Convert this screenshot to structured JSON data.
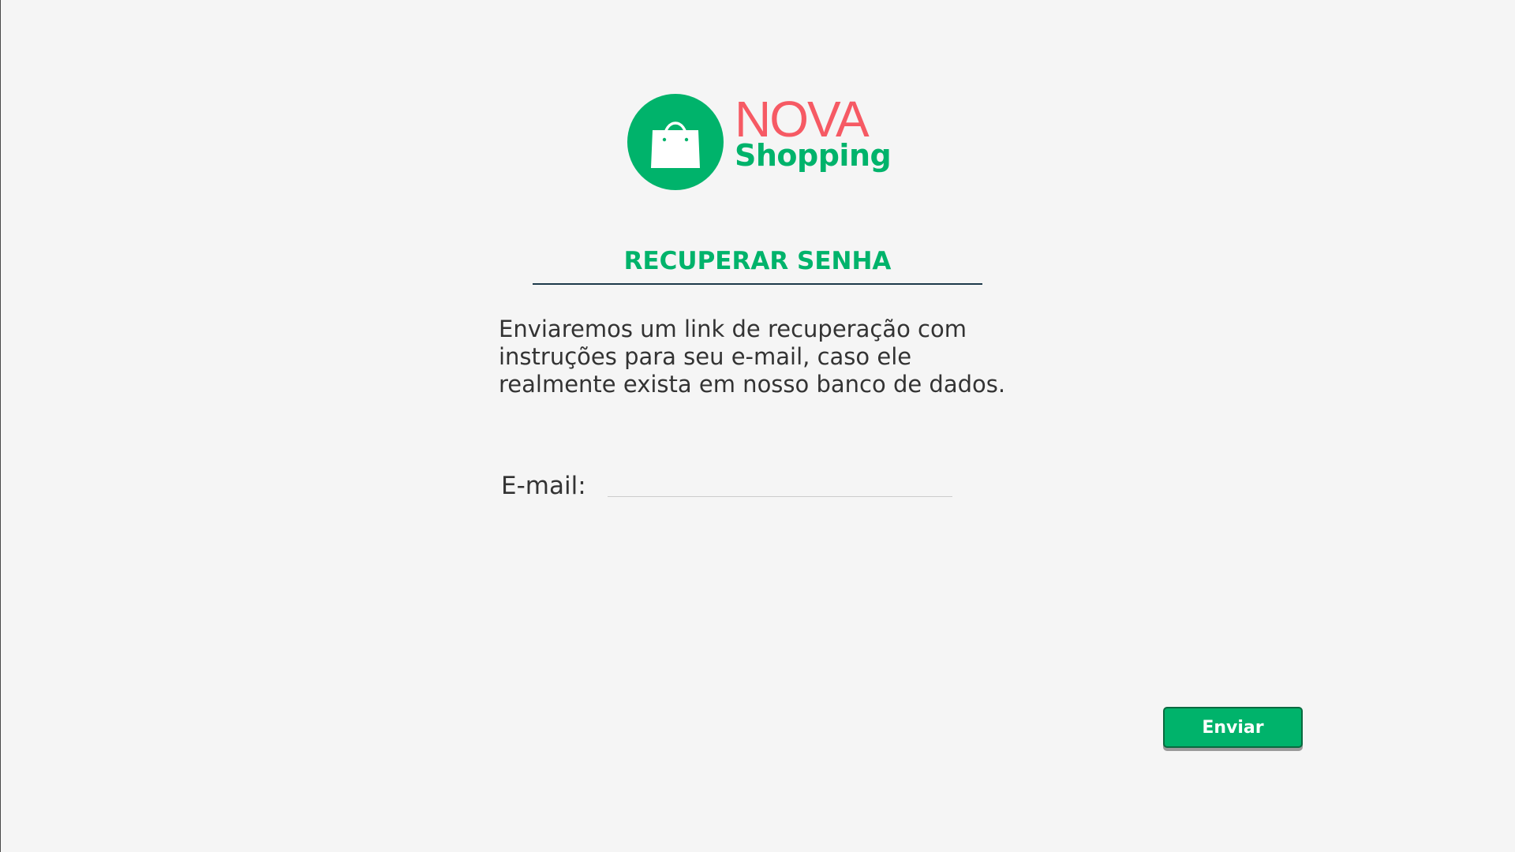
{
  "logo": {
    "line1": "NOVA",
    "line2": "Shopping",
    "icon": "shopping-bag-icon",
    "circle_color": "#00b36b",
    "nova_color": "#f65a64"
  },
  "title": "RECUPERAR SENHA",
  "description": "Enviaremos um link de recuperação com instruções para seu e-mail, caso ele realmente exista em nosso banco de dados.",
  "form": {
    "email_label": "E-mail:",
    "email_value": "",
    "email_placeholder": ""
  },
  "actions": {
    "send_label": "Enviar"
  },
  "colors": {
    "accent": "#00b36b",
    "background": "#f5f5f5",
    "title_rule": "#1d3a4a"
  }
}
